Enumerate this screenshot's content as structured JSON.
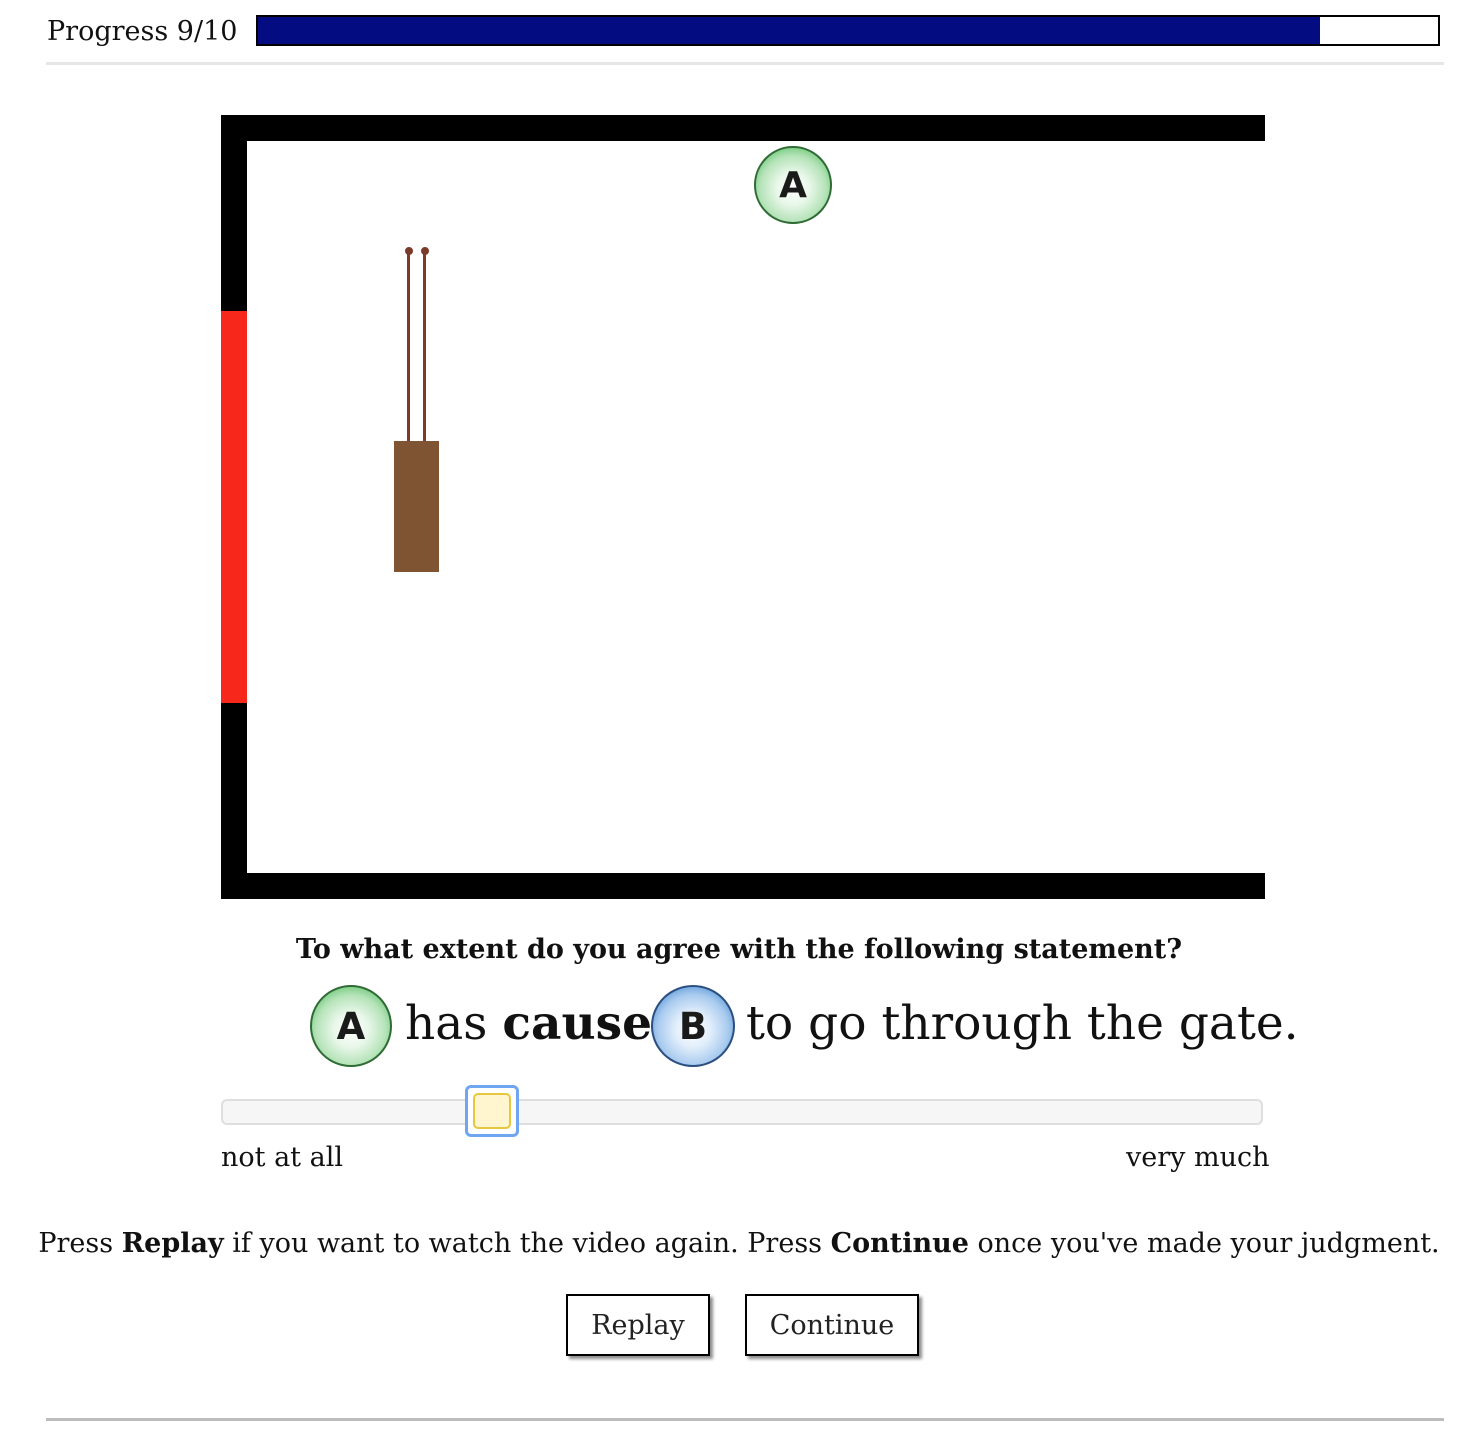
{
  "header": {
    "progress_label": "Progress 9/10",
    "progress_fraction": 0.9,
    "progress_color": "#030c80"
  },
  "scene": {
    "agent_top_label": "A",
    "gate_color": "#f7271c",
    "block_color": "#7f5433"
  },
  "question": {
    "prompt": "To what extent do you agree with the following statement?",
    "agent_a_label": "A",
    "verb_prefix": "has",
    "verb_bold": "caused",
    "agent_b_label": "B",
    "statement_suffix": "to go through the gate."
  },
  "slider": {
    "value_fraction": 0.26,
    "min_label": "not at all",
    "max_label": "very much"
  },
  "instructions": {
    "part1": "Press",
    "replay_word": "Replay",
    "part2": "if you want to watch the video again. Press",
    "continue_word": "Continue",
    "part3": "once you've made your judgment."
  },
  "buttons": {
    "replay_label": "Replay",
    "continue_label": "Continue"
  }
}
